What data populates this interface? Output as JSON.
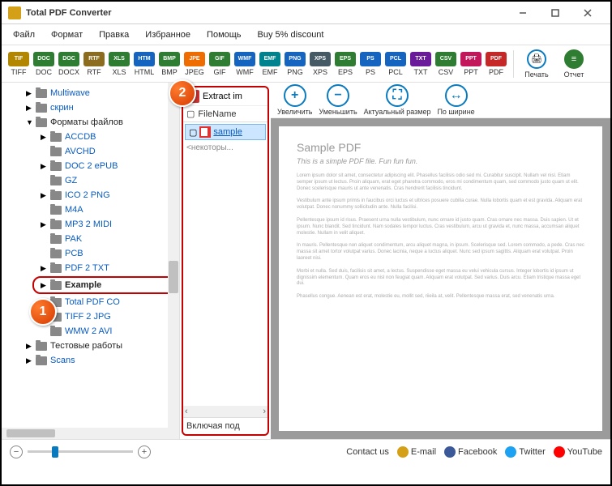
{
  "window": {
    "title": "Total PDF Converter"
  },
  "menu": {
    "items": [
      "Файл",
      "Формат",
      "Правка",
      "Избранное",
      "Помощь",
      "Buy 5% discount"
    ]
  },
  "formats": [
    {
      "code": "TIFF",
      "color": "#b38600"
    },
    {
      "code": "DOC",
      "color": "#2e7d32"
    },
    {
      "code": "DOCX",
      "color": "#2e7d32"
    },
    {
      "code": "RTF",
      "color": "#8c6d1f"
    },
    {
      "code": "XLS",
      "color": "#2e7d32"
    },
    {
      "code": "HTML",
      "color": "#1565c0"
    },
    {
      "code": "BMP",
      "color": "#2e7d32"
    },
    {
      "code": "JPEG",
      "color": "#ef6c00"
    },
    {
      "code": "GIF",
      "color": "#2e7d32"
    },
    {
      "code": "WMF",
      "color": "#1565c0"
    },
    {
      "code": "EMF",
      "color": "#00838f"
    },
    {
      "code": "PNG",
      "color": "#1565c0"
    },
    {
      "code": "XPS",
      "color": "#455a64"
    },
    {
      "code": "EPS",
      "color": "#2e7d32"
    },
    {
      "code": "PS",
      "color": "#1565c0"
    },
    {
      "code": "PCL",
      "color": "#1565c0"
    },
    {
      "code": "TXT",
      "color": "#6a1b9a"
    },
    {
      "code": "CSV",
      "color": "#2e7d32"
    },
    {
      "code": "PPT",
      "color": "#c2185b"
    },
    {
      "code": "PDF",
      "color": "#c62828"
    }
  ],
  "bigtools": {
    "print": "Печать",
    "report": "Отчет"
  },
  "tree": [
    {
      "label": "Multiwave",
      "level": 1,
      "arrow": "▶"
    },
    {
      "label": "скрин",
      "level": 1,
      "arrow": "▶"
    },
    {
      "label": "Форматы файлов",
      "level": 1,
      "arrow": "▼",
      "plain": true
    },
    {
      "label": "ACCDB",
      "level": 2,
      "arrow": "▶"
    },
    {
      "label": "AVCHD",
      "level": 2,
      "arrow": ""
    },
    {
      "label": "DOC 2 ePUB",
      "level": 2,
      "arrow": "▶"
    },
    {
      "label": "GZ",
      "level": 2,
      "arrow": ""
    },
    {
      "label": "ICO 2 PNG",
      "level": 2,
      "arrow": "▶"
    },
    {
      "label": "M4A",
      "level": 2,
      "arrow": ""
    },
    {
      "label": "MP3 2 MIDI",
      "level": 2,
      "arrow": "▶"
    },
    {
      "label": "PAK",
      "level": 2,
      "arrow": ""
    },
    {
      "label": "PCB",
      "level": 2,
      "arrow": ""
    },
    {
      "label": "PDF 2 TXT",
      "level": 2,
      "arrow": "▶"
    },
    {
      "label": "Example",
      "level": 2,
      "arrow": "▶",
      "hl": true,
      "plain": true
    },
    {
      "label": "Total PDF CO",
      "level": 2,
      "arrow": "▶"
    },
    {
      "label": "TIFF 2 JPG",
      "level": 2,
      "arrow": "▶"
    },
    {
      "label": "WMW 2 AVI",
      "level": 2,
      "arrow": ""
    },
    {
      "label": "Тестовые работы",
      "level": 1,
      "arrow": "▶",
      "plain": true
    },
    {
      "label": "Scans",
      "level": 1,
      "arrow": "▶"
    }
  ],
  "filepane": {
    "extract": "Extract im",
    "col": "FileName",
    "file": "sample",
    "some": "<некоторы...",
    "footer": "Включая под"
  },
  "viewtools": {
    "zoomin": "Увеличить",
    "zoomout": "Уменьшить",
    "actual": "Актуальный размер",
    "fitw": "По ширине"
  },
  "pdf": {
    "title": "Sample PDF",
    "sub": "This is a simple PDF file. Fun fun fun.",
    "p1": "Lorem ipsum dolor sit amet, consectetur adipiscing elit. Phasellus facilisis odio sed mi. Curabitur suscipit. Nullam vel nisl. Etiam semper ipsum ut lectus. Proin aliquam, erat eget pharetra commodo, eros mi condimentum quam, sed commodo justo quam ut elit. Donec scelerisque mauris ut ante venenatis. Cras hendrerit facilisis tincidunt.",
    "p2": "Vestibulum ante ipsum primis in faucibus orci luctus et ultrices posuere cubilia curae. Nulla lobortis quam et est gravida. Aliquam erat volutpat. Donec nonummy sollicitudin ante. Nulla facilisi.",
    "p3": "Pellentesque ipsum id risus. Praesent urna nulla vestibulum, nunc ornare id justo quam. Cras ornare nec massa. Duis sapien. Ut et ipsum. Nunc blandit. Sed tincidunt. Nam sodales tempor luctus. Cras vestibulum, arcu ut gravida et, nunc massa, accumsan aliquet molestie. Nullam in velit aliquet.",
    "p4": "In mauris. Pellentesque non aliquet condimentum, arcu aliquet magna, in ipsum. Scelerisque sed. Lorem commodo, a pede. Cras nec massa sit amet tortor volutpat varius. Donec lacinia, neque a luctus aliquet. Nunc sed ipsum sagittis. Aliquam erat volutpat. Proin laoreet nisi.",
    "p5": "Morbi et nulla. Sed duis, facilisis sit amet, a lectus. Suspendisse eget massa eu velui vehicula cursus. Integer lobortis id ipsum ut dignissim elementum. Quam eros eu nisl non feugiat quam. Aliquam erat volutpat. Sed varius. Duis arcu. Etiam tristique massa eget dui.",
    "p6": "Phasellus congue. Aenean est erat, molestie eu, mollit sed, riieila at, velit. Pellentesque massa erat, sed venenatis urna."
  },
  "social": {
    "contact": "Contact us",
    "email": "E-mail",
    "fb": "Facebook",
    "tw": "Twitter",
    "yt": "YouTube"
  },
  "annots": {
    "a1": "1",
    "a2": "2"
  }
}
